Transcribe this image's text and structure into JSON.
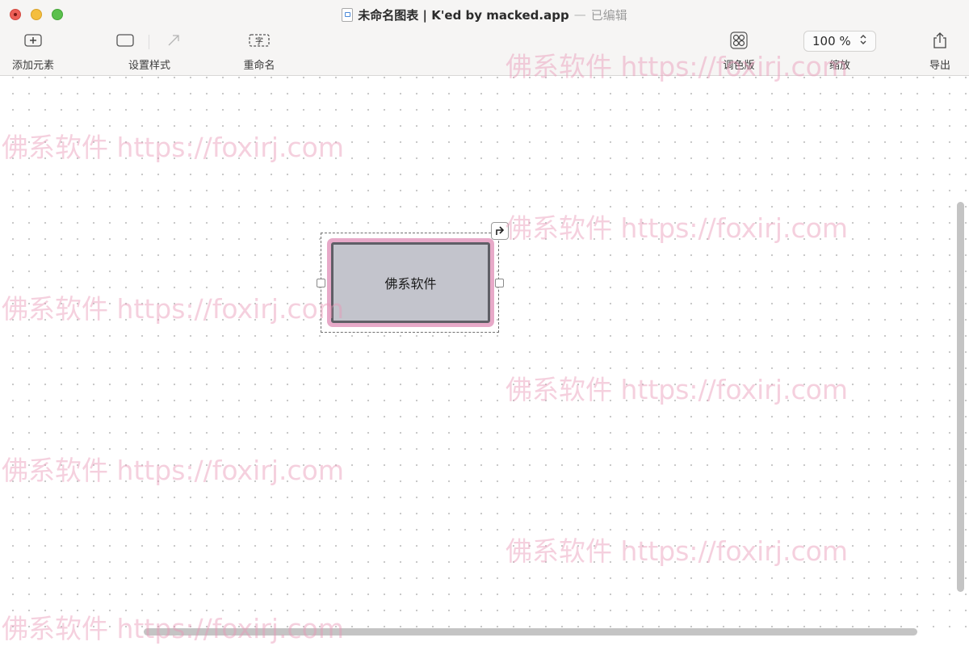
{
  "window": {
    "title": "未命名图表 | K'ed by macked.app",
    "separator": "—",
    "status": "已编辑"
  },
  "toolbar": {
    "add_element": "添加元素",
    "set_style": "设置样式",
    "rename": "重命名",
    "palette": "调色版",
    "zoom_label": "缩放",
    "zoom_value": "100 %",
    "export": "导出"
  },
  "icons": {
    "add": "plus-box-icon",
    "style": "rounded-rect-icon",
    "arrow": "diagonal-arrow-icon",
    "rename": "text-box-icon",
    "palette": "four-circles-grid-icon",
    "stepper": "chevron-up-down-icon",
    "export": "share-icon",
    "connect": "turn-up-right-arrow-icon"
  },
  "canvas": {
    "node_label": "佛系软件"
  },
  "watermark": {
    "text": "佛系软件 https://foxirj.com"
  },
  "colors": {
    "node_fill": "#c3c4cc",
    "node_border": "#5f5f66",
    "node_highlight": "#e7a9c8",
    "watermark": "#e896b6"
  }
}
